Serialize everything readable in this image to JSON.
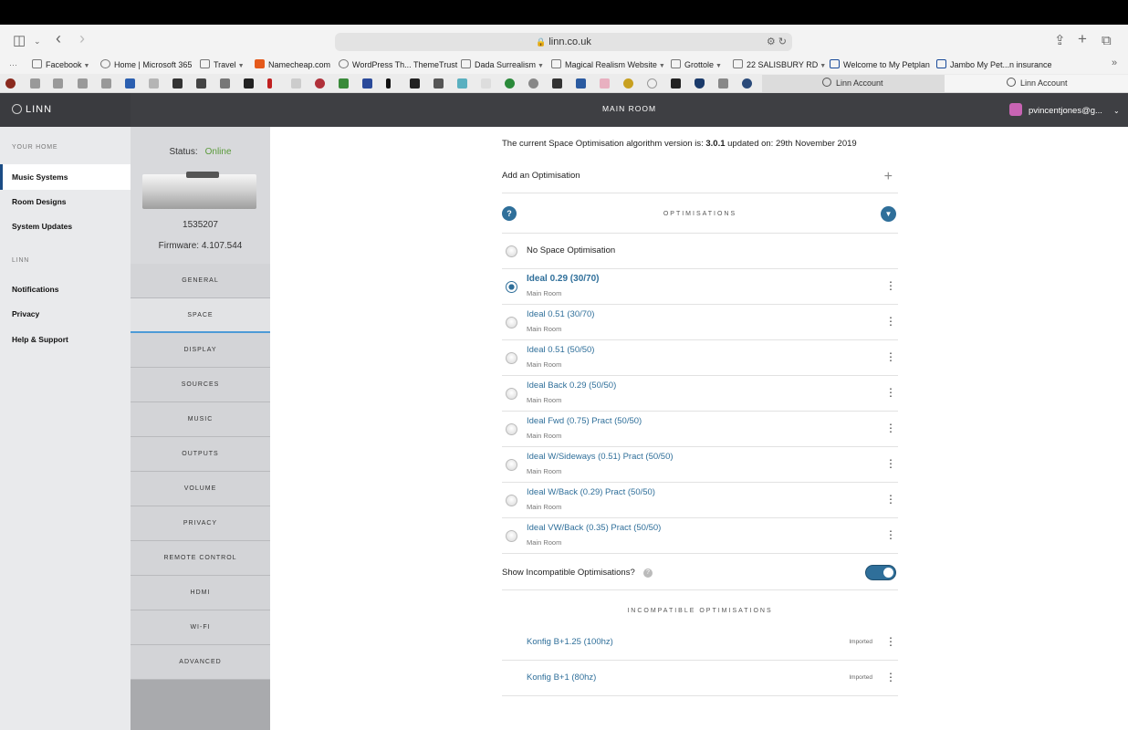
{
  "browser": {
    "url": "linn.co.uk",
    "favorites": [
      {
        "label": "Facebook",
        "caret": true
      },
      {
        "label": "Home | Microsoft 365",
        "caret": false
      },
      {
        "label": "Travel",
        "caret": true
      },
      {
        "label": "Namecheap.com",
        "caret": false
      },
      {
        "label": "WordPress Th... ThemeTrust",
        "caret": false
      },
      {
        "label": "Dada Surrealism",
        "caret": true
      },
      {
        "label": "Magical Realism Website",
        "caret": true
      },
      {
        "label": "Grottole",
        "caret": true
      },
      {
        "label": "22 SALISBURY RD",
        "caret": true
      },
      {
        "label": "Welcome to My Petplan",
        "caret": false
      },
      {
        "label": "Jambo My Pet...n insurance",
        "caret": false
      }
    ],
    "tabs": [
      {
        "label": "Linn Account"
      },
      {
        "label": "Linn Account"
      }
    ]
  },
  "sidebar": {
    "logo": "LINN",
    "section_home": "YOUR HOME",
    "home_items": [
      {
        "label": "Music Systems"
      },
      {
        "label": "Room Designs"
      },
      {
        "label": "System Updates"
      }
    ],
    "section_linn": "LINN",
    "linn_items": [
      {
        "label": "Notifications"
      },
      {
        "label": "Privacy"
      },
      {
        "label": "Help & Support"
      }
    ]
  },
  "header": {
    "title": "MAIN ROOM",
    "user": "pvincentjones@g..."
  },
  "device": {
    "status_label": "Status:",
    "status_value": "Online",
    "serial": "1535207",
    "firmware": "Firmware: 4.107.544",
    "tabs": [
      {
        "label": "GENERAL"
      },
      {
        "label": "SPACE"
      },
      {
        "label": "DISPLAY"
      },
      {
        "label": "SOURCES"
      },
      {
        "label": "MUSIC"
      },
      {
        "label": "OUTPUTS"
      },
      {
        "label": "VOLUME"
      },
      {
        "label": "PRIVACY"
      },
      {
        "label": "REMOTE CONTROL"
      },
      {
        "label": "HDMI"
      },
      {
        "label": "WI-FI"
      },
      {
        "label": "ADVANCED"
      }
    ]
  },
  "main": {
    "version_prefix": "The current Space Optimisation algorithm version is:",
    "version": "3.0.1",
    "version_suffix": "updated on: 29th November 2019",
    "add_label": "Add an Optimisation",
    "optimisations_heading": "OPTIMISATIONS",
    "no_opt_label": "No Space Optimisation",
    "optimisations": [
      {
        "name": "Ideal 0.29 (30/70)",
        "room": "Main Room",
        "selected": true
      },
      {
        "name": "Ideal 0.51 (30/70)",
        "room": "Main Room",
        "selected": false
      },
      {
        "name": "Ideal 0.51 (50/50)",
        "room": "Main Room",
        "selected": false
      },
      {
        "name": "Ideal Back 0.29 (50/50)",
        "room": "Main Room",
        "selected": false
      },
      {
        "name": "Ideal Fwd (0.75) Pract (50/50)",
        "room": "Main Room",
        "selected": false
      },
      {
        "name": "Ideal W/Sideways (0.51) Pract (50/50)",
        "room": "Main Room",
        "selected": false
      },
      {
        "name": "Ideal W/Back (0.29) Pract (50/50)",
        "room": "Main Room",
        "selected": false
      },
      {
        "name": "Ideal VW/Back (0.35) Pract (50/50)",
        "room": "Main Room",
        "selected": false
      }
    ],
    "show_incompatible_label": "Show Incompatible Optimisations?",
    "show_incompatible_on": true,
    "incompatible_heading": "INCOMPATIBLE OPTIMISATIONS",
    "incompatible": [
      {
        "name": "Konfig B+1.25 (100hz)",
        "tag": "Imported"
      },
      {
        "name": "Konfig B+1 (80hz)",
        "tag": "Imported"
      }
    ]
  }
}
